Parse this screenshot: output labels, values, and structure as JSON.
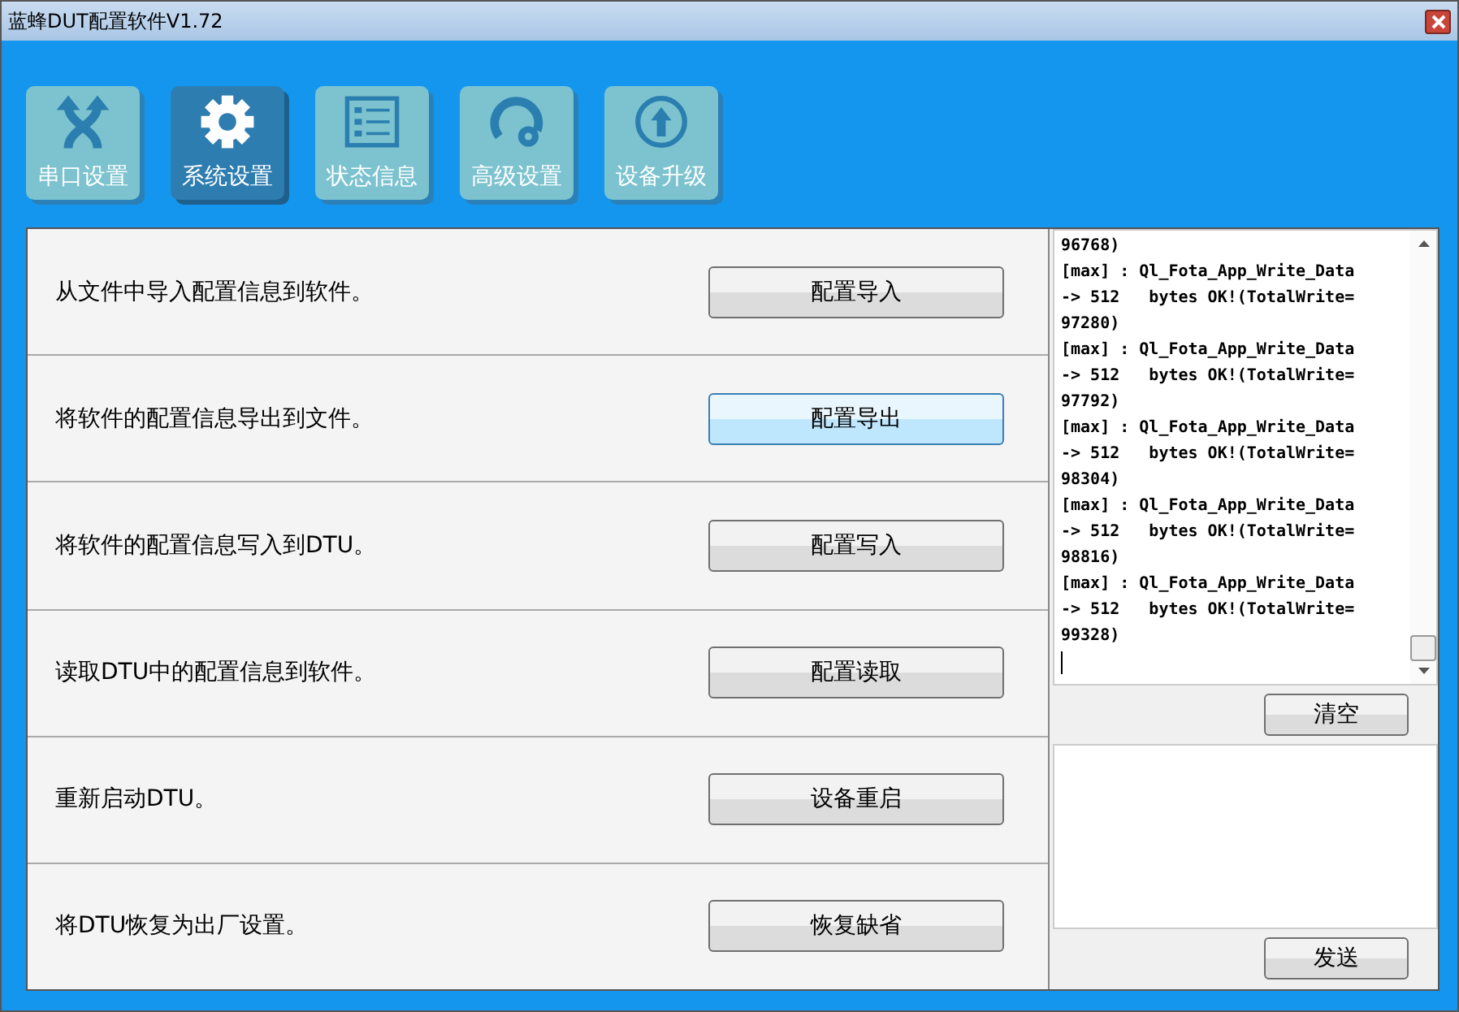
{
  "window": {
    "title": "蓝蜂DUT配置软件V1.72"
  },
  "tabs": [
    {
      "label": "串口设置",
      "selected": false
    },
    {
      "label": "系统设置",
      "selected": true
    },
    {
      "label": "状态信息",
      "selected": false
    },
    {
      "label": "高级设置",
      "selected": false
    },
    {
      "label": "设备升级",
      "selected": false
    }
  ],
  "actions": [
    {
      "description": "从文件中导入配置信息到软件。",
      "button": "配置导入",
      "hovered": false
    },
    {
      "description": "将软件的配置信息导出到文件。",
      "button": "配置导出",
      "hovered": true
    },
    {
      "description": "将软件的配置信息写入到DTU。",
      "button": "配置写入",
      "hovered": false
    },
    {
      "description": "读取DTU中的配置信息到软件。",
      "button": "配置读取",
      "hovered": false
    },
    {
      "description": "重新启动DTU。",
      "button": "设备重启",
      "hovered": false
    },
    {
      "description": "将DTU恢复为出厂设置。",
      "button": "恢复缺省",
      "hovered": false
    }
  ],
  "log": {
    "lines": [
      "96768)",
      "[max] : Ql_Fota_App_Write_Data",
      "-> 512   bytes OK!(TotalWrite=",
      "97280)",
      "[max] : Ql_Fota_App_Write_Data",
      "-> 512   bytes OK!(TotalWrite=",
      "97792)",
      "[max] : Ql_Fota_App_Write_Data",
      "-> 512   bytes OK!(TotalWrite=",
      "98304)",
      "[max] : Ql_Fota_App_Write_Data",
      "-> 512   bytes OK!(TotalWrite=",
      "98816)",
      "[max] : Ql_Fota_App_Write_Data",
      "-> 512   bytes OK!(TotalWrite=",
      "99328)"
    ],
    "clear_button": "清空",
    "send_button": "发送"
  }
}
